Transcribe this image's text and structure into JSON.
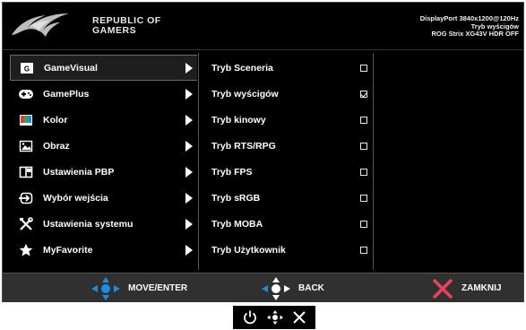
{
  "header": {
    "brand_line1": "REPUBLIC OF",
    "brand_line2": "GAMERS",
    "info_line1": "DisplayPort 3840x1200@120Hz",
    "info_line2": "Tryb wyścigów",
    "info_line3": "ROG Strix XG43V HDR OFF"
  },
  "menu": {
    "items": [
      {
        "label": "GameVisual",
        "icon": "gamevisual-icon"
      },
      {
        "label": "GamePlus",
        "icon": "gamepad-icon"
      },
      {
        "label": "Kolor",
        "icon": "color-icon"
      },
      {
        "label": "Obraz",
        "icon": "image-icon"
      },
      {
        "label": "Ustawienia PBP",
        "icon": "pbp-icon"
      },
      {
        "label": "Wybór wejścia",
        "icon": "input-icon"
      },
      {
        "label": "Ustawienia systemu",
        "icon": "tools-icon"
      },
      {
        "label": "MyFavorite",
        "icon": "star-icon"
      }
    ],
    "selected": "GameVisual"
  },
  "submenu": {
    "items": [
      {
        "label": "Tryb Sceneria",
        "checked": false
      },
      {
        "label": "Tryb wyścigów",
        "checked": true
      },
      {
        "label": "Tryb kinowy",
        "checked": false
      },
      {
        "label": "Tryb RTS/RPG",
        "checked": false
      },
      {
        "label": "Tryb FPS",
        "checked": false
      },
      {
        "label": "Tryb sRGB",
        "checked": false
      },
      {
        "label": "Tryb MOBA",
        "checked": false
      },
      {
        "label": "Tryb Użytkownik",
        "checked": false
      }
    ]
  },
  "footer": {
    "move_label": "MOVE/ENTER",
    "back_label": "BACK",
    "close_label": "ZAMKNIJ"
  },
  "colors": {
    "accent_blue": "#1a8fe0",
    "close_red": "#e8435a",
    "background": "#000000",
    "footer_bg": "#303030"
  }
}
